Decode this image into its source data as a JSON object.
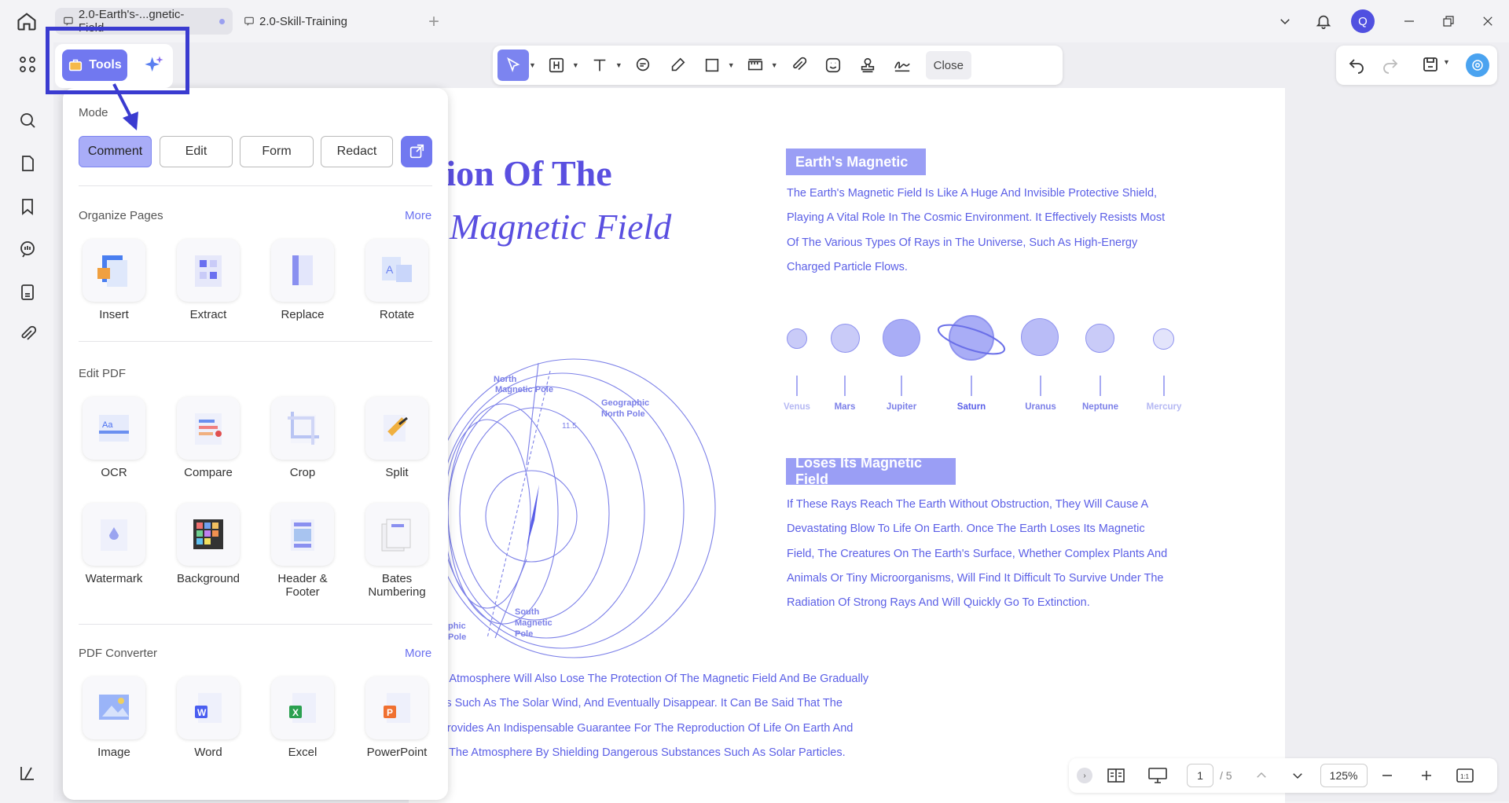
{
  "tabs": [
    {
      "label": "2.0-Earth's-...gnetic-Field"
    },
    {
      "label": "2.0-Skill-Training"
    }
  ],
  "header": {
    "avatar_letter": "Q"
  },
  "toolbar": {
    "close_label": "Close"
  },
  "tools_panel": {
    "tools_label": "Tools",
    "mode_label": "Mode",
    "modes": [
      "Comment",
      "Edit",
      "Form",
      "Redact"
    ],
    "active_mode": "Comment",
    "organize": {
      "title": "Organize Pages",
      "more": "More",
      "items": [
        "Insert",
        "Extract",
        "Replace",
        "Rotate"
      ]
    },
    "edit": {
      "title": "Edit PDF",
      "items": [
        "OCR",
        "Compare",
        "Crop",
        "Split",
        "Watermark",
        "Background",
        "Header & Footer",
        "Bates Numbering"
      ]
    },
    "converter": {
      "title": "PDF Converter",
      "more": "More",
      "items": [
        "Image",
        "Word",
        "Excel",
        "PowerPoint"
      ]
    }
  },
  "document": {
    "title_line1": "tion Of The",
    "title_line2": "Magnetic Field",
    "diagram": {
      "north_mag": "North Magnetic Pole",
      "geo_north": "Geographic North Pole",
      "south_mag": "South Magnetic Pole",
      "geo_south": "phic Pole",
      "angle": "11.5"
    },
    "section1_heading": "Earth's Magnetic",
    "section1_text": [
      "The Earth's Magnetic Field Is Like A Huge And Invisible Protective Shield,",
      "Playing A Vital Role In The Cosmic Environment. It Effectively Resists Most",
      "Of The Various Types Of Rays in The Universe, Such As High-Energy",
      "Charged Particle Flows."
    ],
    "planets": [
      "Venus",
      "Mars",
      "Jupiter",
      "Saturn",
      "Uranus",
      "Neptune",
      "Mercury"
    ],
    "section2_heading": "Loses Its Magnetic Field",
    "section2_text": [
      "If These Rays Reach The Earth Without Obstruction, They Will Cause A",
      "Devastating Blow To Life On Earth. Once The Earth Loses Its Magnetic",
      "Field, The Creatures On The Earth's Surface, Whether Complex Plants And",
      "Animals Or Tiny Microorganisms, Will Find It Difficult To Survive Under The",
      "Radiation Of Strong Rays And Will Quickly Go To Extinction."
    ],
    "bottom_text": [
      "he Atmosphere Will Also Lose The Protection Of The Magnetic Field And Be Gradually",
      "ces Such As The Solar Wind, And Eventually Disappear. It Can Be Said That The",
      "l Provides An Indispensable Guarantee For The Reproduction Of Life On Earth And",
      "Of The Atmosphere By Shielding Dangerous Substances Such As Solar Particles."
    ]
  },
  "pager": {
    "current": "1",
    "total": "/ 5",
    "zoom": "125%"
  },
  "colors": {
    "accent": "#7178f0",
    "text_blue": "#5b5fe6",
    "highlight": "#3a3bd0"
  }
}
